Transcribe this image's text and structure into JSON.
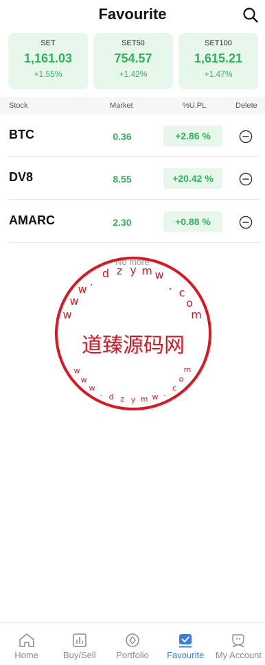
{
  "header": {
    "title": "Favourite"
  },
  "indices": [
    {
      "name": "SET",
      "value": "1,161.03",
      "change": "+1.55%"
    },
    {
      "name": "SET50",
      "value": "754.57",
      "change": "+1.42%"
    },
    {
      "name": "SET100",
      "value": "1,615.21",
      "change": "+1.47%"
    }
  ],
  "table": {
    "headers": {
      "stock": "Stock",
      "market": "Market",
      "pl": "%U.PL",
      "delete": "Delete"
    },
    "rows": [
      {
        "symbol": "BTC",
        "market": "0.36",
        "pl": "+2.86 %"
      },
      {
        "symbol": "DV8",
        "market": "8.55",
        "pl": "+20.42 %"
      },
      {
        "symbol": "AMARC",
        "market": "2.30",
        "pl": "+0.88 %"
      }
    ],
    "end_text": "No more"
  },
  "watermark": {
    "center": "道臻源码网",
    "ring": "www.dzymw.com"
  },
  "nav": {
    "items": [
      {
        "label": "Home",
        "icon": "home-icon"
      },
      {
        "label": "Buy/Sell",
        "icon": "buy-sell-icon"
      },
      {
        "label": "Portfolio",
        "icon": "portfolio-icon"
      },
      {
        "label": "Favourite",
        "icon": "favourite-icon",
        "active": true
      },
      {
        "label": "My Account",
        "icon": "account-icon"
      }
    ]
  },
  "colors": {
    "up": "#2fb45a",
    "card_bg": "#e7f7ec",
    "active": "#3b7ddd",
    "stamp": "#e0151f"
  }
}
